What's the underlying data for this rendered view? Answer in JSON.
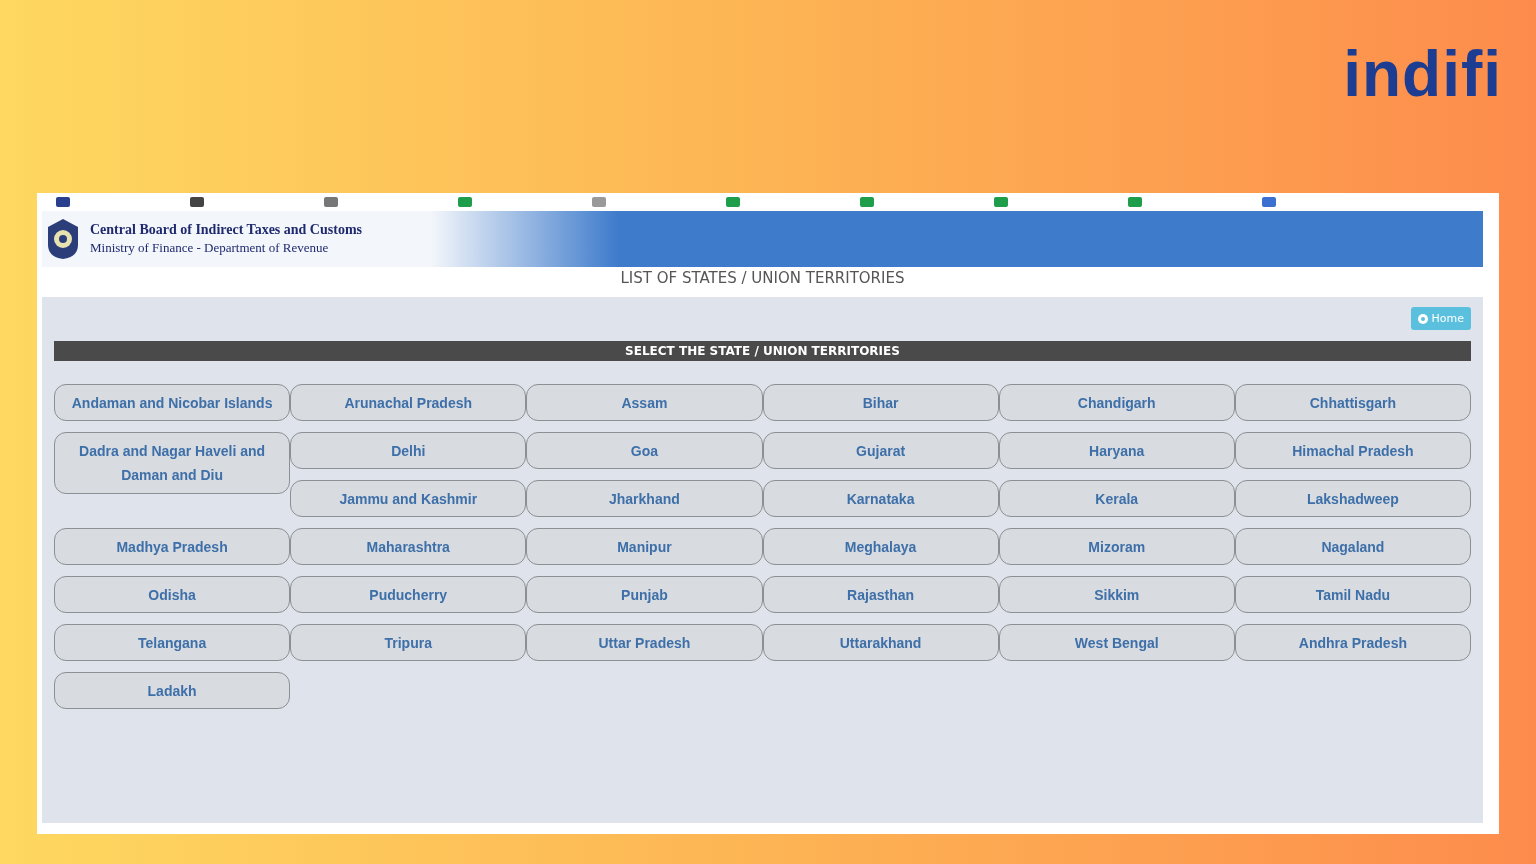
{
  "brand": {
    "logo": "indifi"
  },
  "header": {
    "title": "Central Board of Indirect Taxes and Customs",
    "subtitle": "Ministry of Finance - Department of Revenue"
  },
  "page_title": "LIST OF STATES / UNION TERRITORIES",
  "home_button": {
    "label": "Home"
  },
  "section_title": "SELECT THE STATE / UNION TERRITORIES",
  "states": [
    {
      "label": "Andaman and Nicobar Islands",
      "kind": "single"
    },
    {
      "label": "Arunachal Pradesh",
      "kind": "single"
    },
    {
      "label": "Assam",
      "kind": "single"
    },
    {
      "label": "Bihar",
      "kind": "single"
    },
    {
      "label": "Chandigarh",
      "kind": "single"
    },
    {
      "label": "Chhattisgarh",
      "kind": "single"
    },
    {
      "label": "Dadra and Nagar Haveli and Daman and Diu",
      "kind": "tall"
    },
    {
      "label": "Delhi",
      "kind": "single"
    },
    {
      "label": "Goa",
      "kind": "single"
    },
    {
      "label": "Gujarat",
      "kind": "single"
    },
    {
      "label": "Haryana",
      "kind": "single"
    },
    {
      "label": "Himachal Pradesh",
      "kind": "single"
    },
    {
      "label": "Jammu and Kashmir",
      "kind": "single"
    },
    {
      "label": "Jharkhand",
      "kind": "single"
    },
    {
      "label": "Karnataka",
      "kind": "single"
    },
    {
      "label": "Kerala",
      "kind": "single"
    },
    {
      "label": "Lakshadweep",
      "kind": "single"
    },
    {
      "label": "Madhya Pradesh",
      "kind": "single"
    },
    {
      "label": "Maharashtra",
      "kind": "single"
    },
    {
      "label": "Manipur",
      "kind": "single"
    },
    {
      "label": "Meghalaya",
      "kind": "single"
    },
    {
      "label": "Mizoram",
      "kind": "single"
    },
    {
      "label": "Nagaland",
      "kind": "single"
    },
    {
      "label": "Odisha",
      "kind": "single"
    },
    {
      "label": "Puducherry",
      "kind": "single"
    },
    {
      "label": "Punjab",
      "kind": "single"
    },
    {
      "label": "Rajasthan",
      "kind": "single"
    },
    {
      "label": "Sikkim",
      "kind": "single"
    },
    {
      "label": "Tamil Nadu",
      "kind": "single"
    },
    {
      "label": "Telangana",
      "kind": "single"
    },
    {
      "label": "Tripura",
      "kind": "single"
    },
    {
      "label": "Uttar Pradesh",
      "kind": "single"
    },
    {
      "label": "Uttarakhand",
      "kind": "single"
    },
    {
      "label": "West Bengal",
      "kind": "single"
    },
    {
      "label": "Andhra Pradesh",
      "kind": "single"
    },
    {
      "label": "Ladakh",
      "kind": "single"
    }
  ]
}
